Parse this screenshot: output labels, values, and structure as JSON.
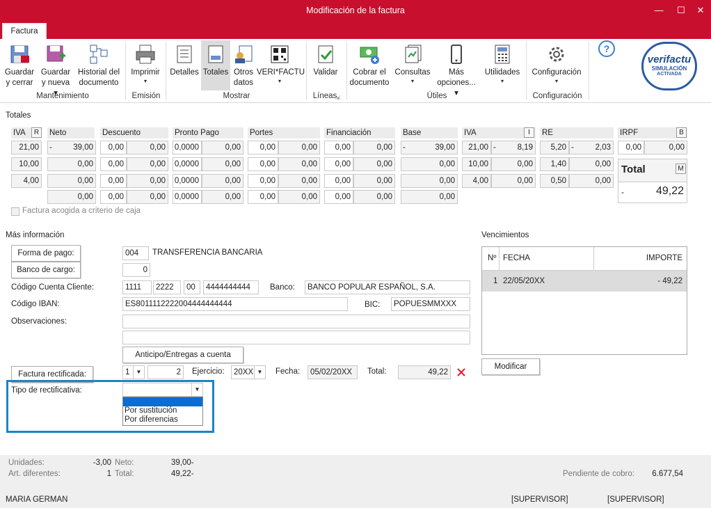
{
  "window": {
    "title": "Modificación de la factura",
    "minimize": "—",
    "maximize": "☐",
    "close": "✕"
  },
  "tab": "Factura",
  "ribbon": {
    "buttons": [
      {
        "line1": "Guardar",
        "line2": "y cerrar",
        "icon": "save-close-icon"
      },
      {
        "line1": "Guardar",
        "line2": "y nueva ▾",
        "icon": "save-new-icon"
      },
      {
        "line1": "Historial del",
        "line2": "documento",
        "icon": "history-icon"
      },
      {
        "line1": "Imprimir",
        "line2": "▾",
        "icon": "printer-icon"
      },
      {
        "line1": "Detalles",
        "line2": "",
        "icon": "details-icon"
      },
      {
        "line1": "Totales",
        "line2": "",
        "icon": "totals-icon"
      },
      {
        "line1": "Otros",
        "line2": "datos",
        "icon": "other-data-icon"
      },
      {
        "line1": "VERI*FACTU",
        "line2": "▾",
        "icon": "qr-icon"
      },
      {
        "line1": "Validar",
        "line2": "",
        "icon": "validate-icon"
      },
      {
        "line1": "Cobrar el",
        "line2": "documento",
        "icon": "collect-icon"
      },
      {
        "line1": "Consultas",
        "line2": "▾",
        "icon": "queries-icon"
      },
      {
        "line1": "Más",
        "line2": "opciones... ▾",
        "icon": "mobile-icon"
      },
      {
        "line1": "Utilidades",
        "line2": "▾",
        "icon": "calculator-icon"
      },
      {
        "line1": "Configuración",
        "line2": "▾",
        "icon": "gear-icon"
      }
    ],
    "groups": [
      "Mantenimiento",
      "Emisión",
      "Mostrar",
      "Líneas",
      "Útiles",
      "Configuración"
    ],
    "help": "?",
    "verifactu": {
      "brand": "verifactu",
      "line1": "SIMULACIÓN",
      "line2": "ACTIVADA"
    }
  },
  "totales": {
    "label": "Totales",
    "headers": {
      "iva": "IVA",
      "r": "R",
      "neto": "Neto",
      "descuento": "Descuento",
      "pronto_pago": "Pronto Pago",
      "portes": "Portes",
      "financiacion": "Financiación",
      "base": "Base",
      "iva2": "IVA",
      "i": "I",
      "re": "RE",
      "irpf": "IRPF",
      "b": "B"
    },
    "rows": [
      {
        "iva": "21,00",
        "neto_sign": "-",
        "neto": "39,00",
        "d1": "0,00",
        "d2": "0,00",
        "p1": "0,0000",
        "p2": "0,00",
        "po1": "0,00",
        "po2": "0,00",
        "f1": "0,00",
        "f2": "0,00",
        "base_sign": "-",
        "base": "39,00",
        "iva_pct": "21,00",
        "iva_sign": "-",
        "iva_val": "8,19",
        "re_pct": "5,20",
        "re_sign": "-",
        "re_val": "2,03"
      },
      {
        "iva": "10,00",
        "neto_sign": "",
        "neto": "0,00",
        "d1": "0,00",
        "d2": "0,00",
        "p1": "0,0000",
        "p2": "0,00",
        "po1": "0,00",
        "po2": "0,00",
        "f1": "0,00",
        "f2": "0,00",
        "base_sign": "",
        "base": "0,00",
        "iva_pct": "10,00",
        "iva_sign": "",
        "iva_val": "0,00",
        "re_pct": "1,40",
        "re_sign": "",
        "re_val": "0,00"
      },
      {
        "iva": "4,00",
        "neto_sign": "",
        "neto": "0,00",
        "d1": "0,00",
        "d2": "0,00",
        "p1": "0,0000",
        "p2": "0,00",
        "po1": "0,00",
        "po2": "0,00",
        "f1": "0,00",
        "f2": "0,00",
        "base_sign": "",
        "base": "0,00",
        "iva_pct": "4,00",
        "iva_sign": "",
        "iva_val": "0,00",
        "re_pct": "0,50",
        "re_sign": "",
        "re_val": "0,00"
      },
      {
        "iva": "",
        "neto_sign": "",
        "neto": "0,00",
        "d1": "0,00",
        "d2": "0,00",
        "p1": "0,0000",
        "p2": "0,00",
        "po1": "0,00",
        "po2": "0,00",
        "f1": "0,00",
        "f2": "0,00",
        "base_sign": "",
        "base": "0,00"
      }
    ],
    "irpf_pct": "0,00",
    "irpf_val": "0,00",
    "total_label": "Total",
    "total_m": "M",
    "total_sign": "-",
    "total_value": "49,22",
    "criterio_caja": "Factura acogida a criterio de caja"
  },
  "mas_info": {
    "label": "Más información",
    "forma_pago_btn": "Forma de pago:",
    "forma_pago_code": "004",
    "forma_pago_desc": "TRANSFERENCIA BANCARIA",
    "banco_cargo_btn": "Banco de cargo:",
    "banco_cargo_val": "0",
    "codigo_cuenta_label": "Código Cuenta Cliente:",
    "cc1": "1111",
    "cc2": "2222",
    "cc3": "00",
    "cc4": "4444444444",
    "banco_label": "Banco:",
    "banco_val": "BANCO POPULAR ESPAÑOL, S.A.",
    "iban_label": "Código IBAN:",
    "iban_val": "ES8011112222004444444444",
    "bic_label": "BIC:",
    "bic_val": "POPUESMMXXX",
    "observaciones_label": "Observaciones:",
    "anticipo_btn": "Anticipo/Entregas a cuenta",
    "factura_rect_btn": "Factura rectificada:",
    "rect_serie": "1",
    "rect_num": "2",
    "ejercicio_label": "Ejercicio:",
    "ejercicio_val": "20XX",
    "fecha_label": "Fecha:",
    "fecha_val": "05/02/20XX",
    "total_label": "Total:",
    "total_val": "49,22",
    "tipo_rect_label": "Tipo de rectificativa:",
    "tipo_options": [
      "Por sustitución",
      "Por diferencias"
    ]
  },
  "vencimientos": {
    "label": "Vencimientos",
    "col_n": "Nº",
    "col_fecha": "FECHA",
    "col_importe": "IMPORTE",
    "rows": [
      {
        "n": "1",
        "fecha": "22/05/20XX",
        "importe": "- 49,22"
      }
    ],
    "modificar_btn": "Modificar"
  },
  "footer": {
    "unidades_label": "Unidades:",
    "unidades_val": "-3,00",
    "neto_label": "Neto:",
    "neto_val": "39,00-",
    "art_label": "Art. diferentes:",
    "art_val": "1",
    "total_label": "Total:",
    "total_val": "49,22-",
    "pendiente_label": "Pendiente de cobro:",
    "pendiente_val": "6.677,54",
    "user": "MARIA GERMAN",
    "role1": "[SUPERVISOR]",
    "role2": "[SUPERVISOR]"
  }
}
